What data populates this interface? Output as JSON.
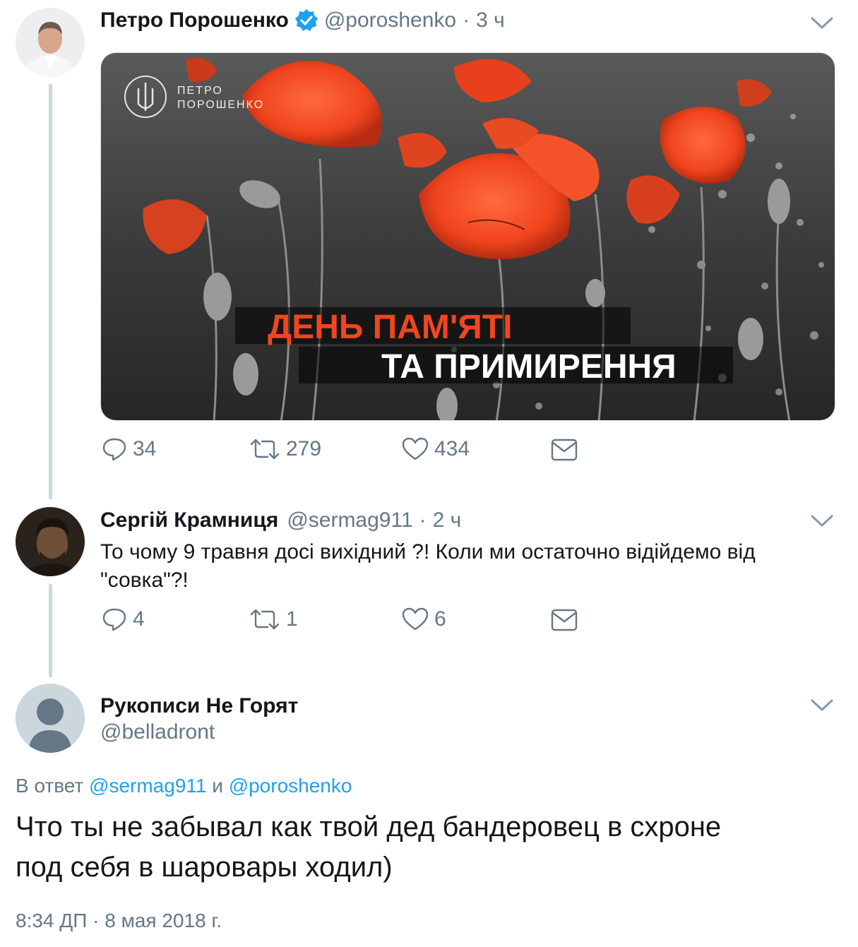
{
  "colors": {
    "text": "#14171a",
    "secondary": "#657786",
    "link": "#1da1f2",
    "thread_line": "#ccd6dd",
    "verified": "#1da1f2"
  },
  "tweet1": {
    "name": "Петро Порошенко",
    "verified": true,
    "handle": "@poroshenko",
    "separator": "·",
    "time": "3 ч",
    "media": {
      "logo_line1": "ПЕТРО",
      "logo_line2": "ПОРОШЕНКО",
      "headline_line1": "ДЕНЬ ПАМ'ЯТІ",
      "headline_line2": "ТА ПРИМИРЕННЯ"
    },
    "replies": "34",
    "retweets": "279",
    "likes": "434",
    "icons": [
      "reply-icon",
      "retweet-icon",
      "like-icon",
      "dm-icon"
    ]
  },
  "tweet2": {
    "name": "Сергій Крамниця",
    "handle": "@sermag911",
    "separator": "·",
    "time": "2 ч",
    "text_line1": "То чому 9 травня досі вихідний ?! Коли ми остаточно відійдемо  від",
    "text_line2": "\"совка\"?!",
    "replies": "4",
    "retweets": "1",
    "likes": "6"
  },
  "tweet3": {
    "name": "Рукописи Не Горят",
    "handle": "@belladront",
    "reply_prefix": "В ответ",
    "reply_mention1": "@sermag911",
    "reply_conj": "и",
    "reply_mention2": "@poroshenko",
    "text_line1": "Что ты не забывал как твой дед бандеровец в схроне",
    "text_line2": "под себя в шаровары ходил)",
    "timestamp": "8:34 ДП · 8 мая 2018 г."
  }
}
